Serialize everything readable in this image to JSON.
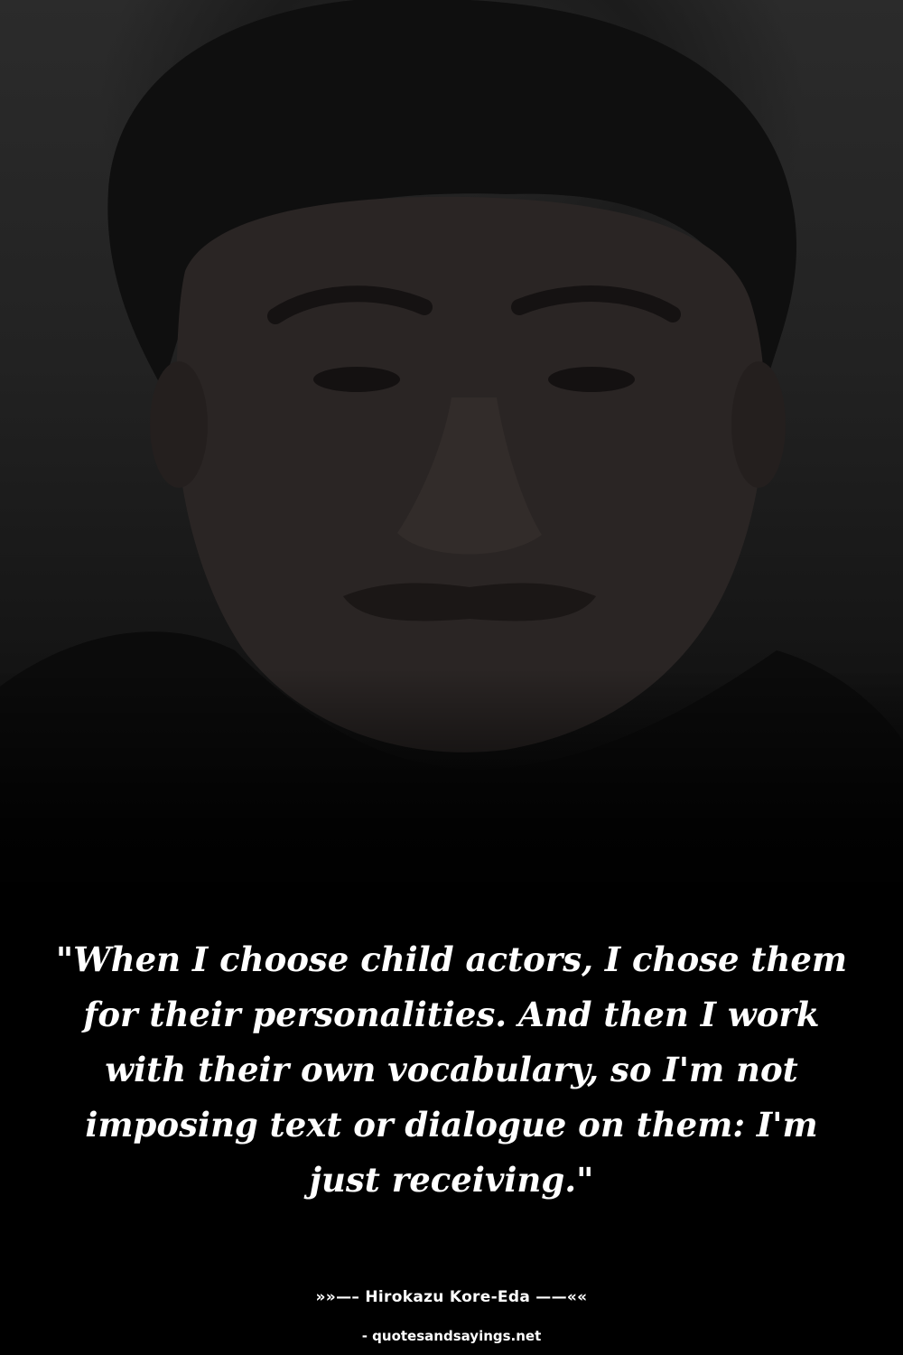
{
  "quote": {
    "text": "\"When I choose child actors, I chose them for their personalities. And then I work with their own vocabulary, so I'm not imposing text or dialogue on them: I'm just receiving.\""
  },
  "author": {
    "text": "»»—– Hirokazu Kore-Eda ——««"
  },
  "source": {
    "text": "- quotesandsayings.net"
  },
  "photo": {
    "subject": "portrait-photo"
  },
  "colors": {
    "background": "#000000",
    "text": "#ffffff"
  }
}
